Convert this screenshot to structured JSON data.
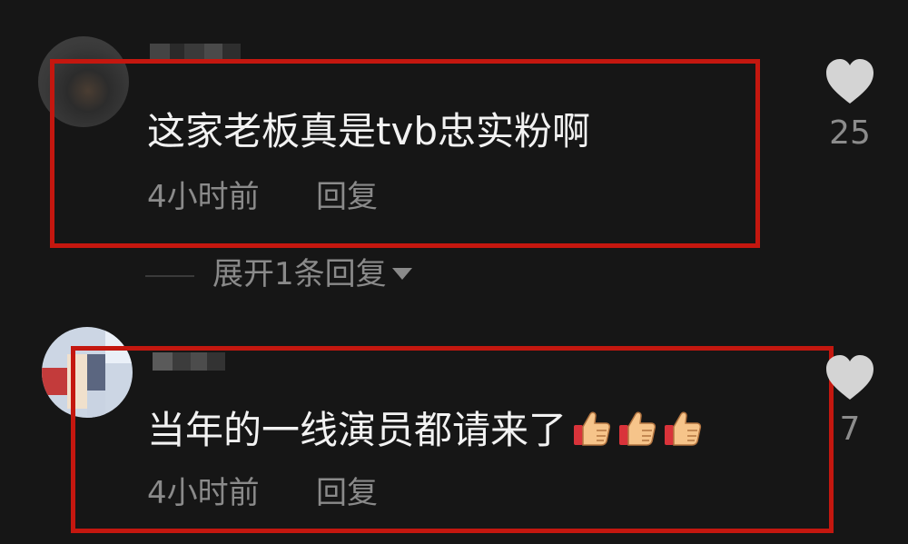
{
  "comments": [
    {
      "text": "这家老板真是tvb忠实粉啊",
      "time": "4小时前",
      "reply_label": "回复",
      "likes": "25",
      "expand_label": "展开1条回复"
    },
    {
      "text": "当年的一线演员都请来了",
      "emoji": [
        "thumbs-up-icon",
        "thumbs-up-icon",
        "thumbs-up-icon"
      ],
      "time": "4小时前",
      "reply_label": "回复",
      "likes": "7"
    }
  ],
  "colors": {
    "background": "#161616",
    "highlight_box": "#c4170f",
    "text_primary": "#f2f2f2",
    "text_secondary": "#8a8a8a"
  }
}
